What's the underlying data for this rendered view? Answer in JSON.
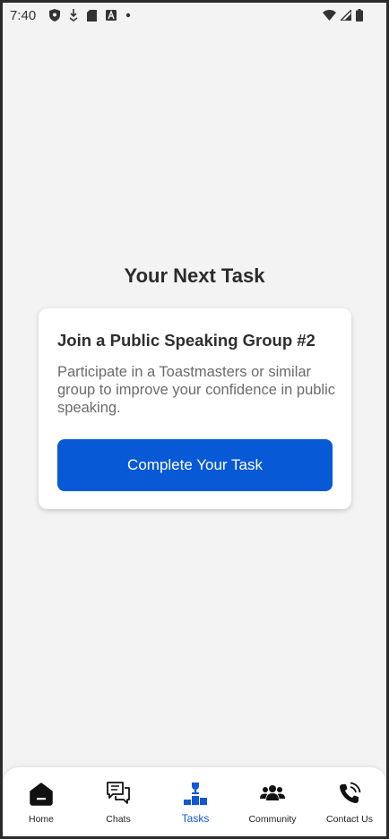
{
  "status_bar": {
    "time": "7:40",
    "left_icons": [
      "shield-icon",
      "download-icon",
      "sd-card-icon",
      "font-icon",
      "dot-icon"
    ],
    "right_icons": [
      "wifi-icon",
      "signal-icon",
      "battery-icon"
    ]
  },
  "main": {
    "title": "Your Next Task",
    "task": {
      "title": "Join a Public Speaking Group #2",
      "description": "Participate in a Toastmasters or similar group to improve your confidence in public speaking.",
      "button_label": "Complete Your Task"
    }
  },
  "bottom_nav": {
    "items": [
      {
        "label": "Home",
        "icon": "home-icon"
      },
      {
        "label": "Chats",
        "icon": "chats-icon"
      },
      {
        "label": "Tasks",
        "icon": "tasks-icon",
        "active": true
      },
      {
        "label": "Community",
        "icon": "community-icon"
      },
      {
        "label": "Contact Us",
        "icon": "phone-icon"
      }
    ],
    "active_color": "#1456d6"
  },
  "colors": {
    "accent": "#0759d6",
    "background": "#f3f3f3"
  }
}
